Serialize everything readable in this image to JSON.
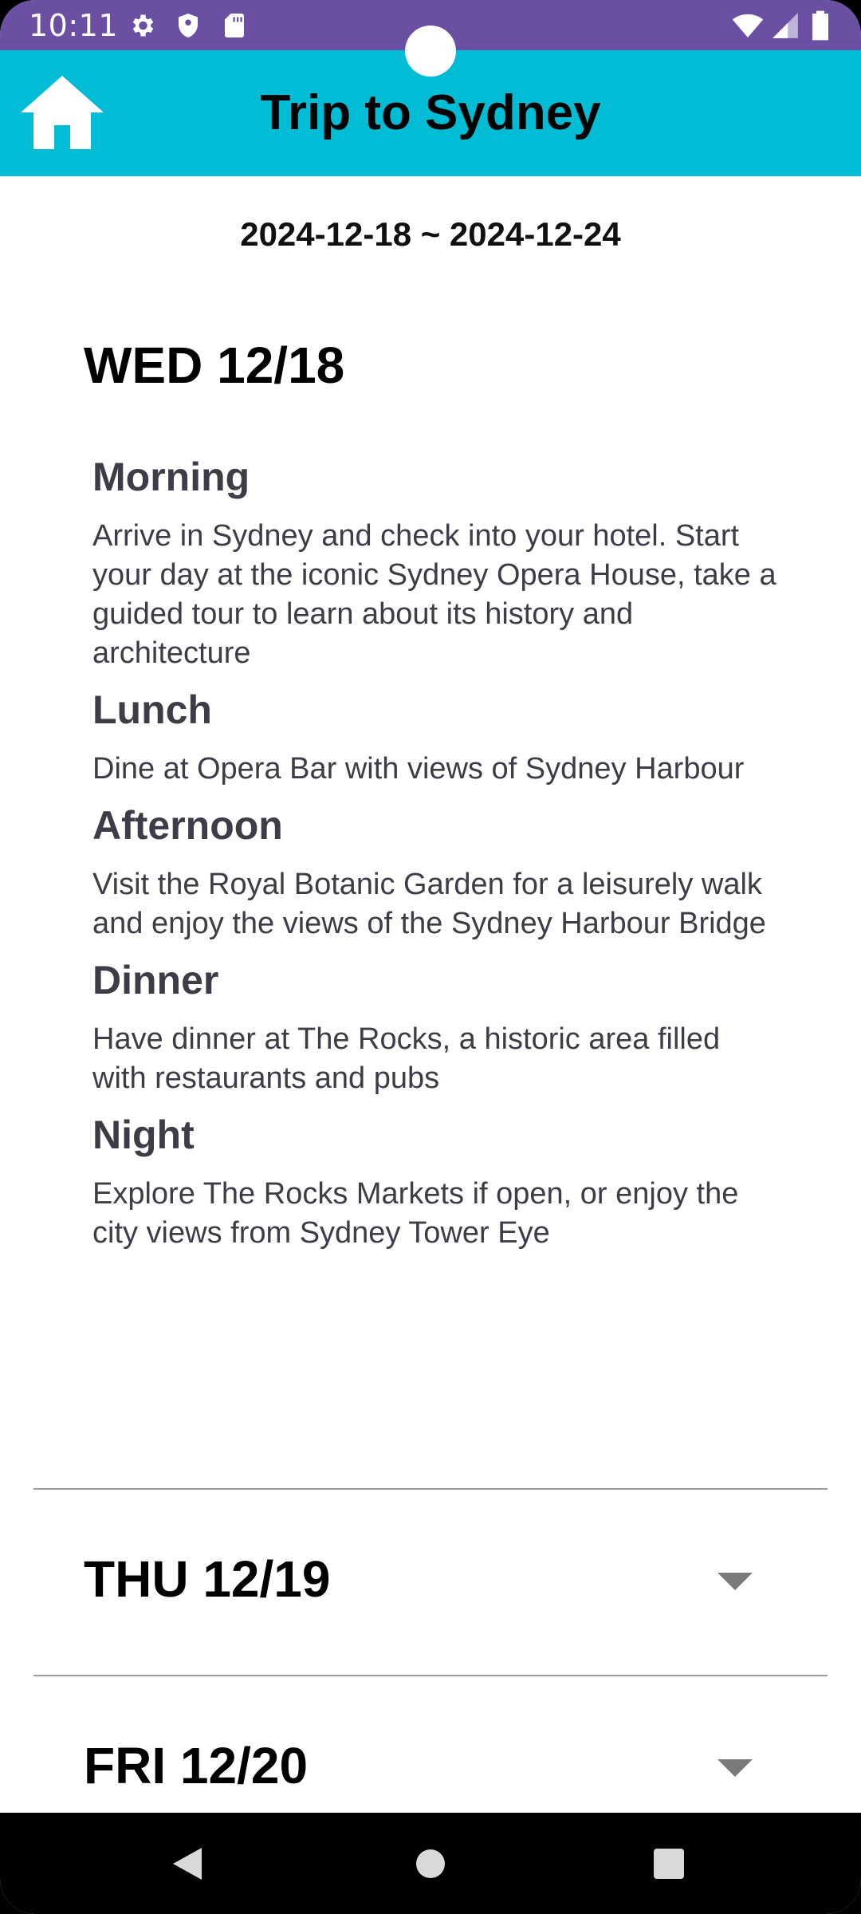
{
  "status_bar": {
    "time": "10:11",
    "background_color": "#6a4fa3",
    "left_icons": [
      "gear-icon",
      "shield-icon",
      "sd-card-icon"
    ],
    "right_icons": [
      "wifi-icon",
      "signal-icon",
      "battery-icon"
    ]
  },
  "app_bar": {
    "title": "Trip to Sydney",
    "background_color": "#00bcd4",
    "home_icon": "home-icon"
  },
  "trip": {
    "date_range": "2024-12-18 ~ 2024-12-24"
  },
  "days": [
    {
      "label": "WED 12/18",
      "expanded": true,
      "sections": [
        {
          "title": "Morning",
          "text": "Arrive in Sydney and check into your hotel. Start your day at the iconic Sydney Opera House, take a guided tour to learn about its history and architecture"
        },
        {
          "title": "Lunch",
          "text": "Dine at Opera Bar with views of Sydney Harbour"
        },
        {
          "title": "Afternoon",
          "text": "Visit the Royal Botanic Garden for a leisurely walk and enjoy the views of the Sydney Harbour Bridge"
        },
        {
          "title": "Dinner",
          "text": "Have dinner at The Rocks, a historic area filled with restaurants and pubs"
        },
        {
          "title": "Night",
          "text": "Explore The Rocks Markets if open, or enjoy the city views from Sydney Tower Eye"
        }
      ]
    },
    {
      "label": "THU 12/19",
      "expanded": false,
      "expand_icon": "chevron-down-icon"
    },
    {
      "label": "FRI 12/20",
      "expanded": false,
      "expand_icon": "chevron-down-icon"
    }
  ],
  "nav_bar": {
    "buttons": [
      "back-icon",
      "home-circle-icon",
      "recents-icon"
    ]
  }
}
